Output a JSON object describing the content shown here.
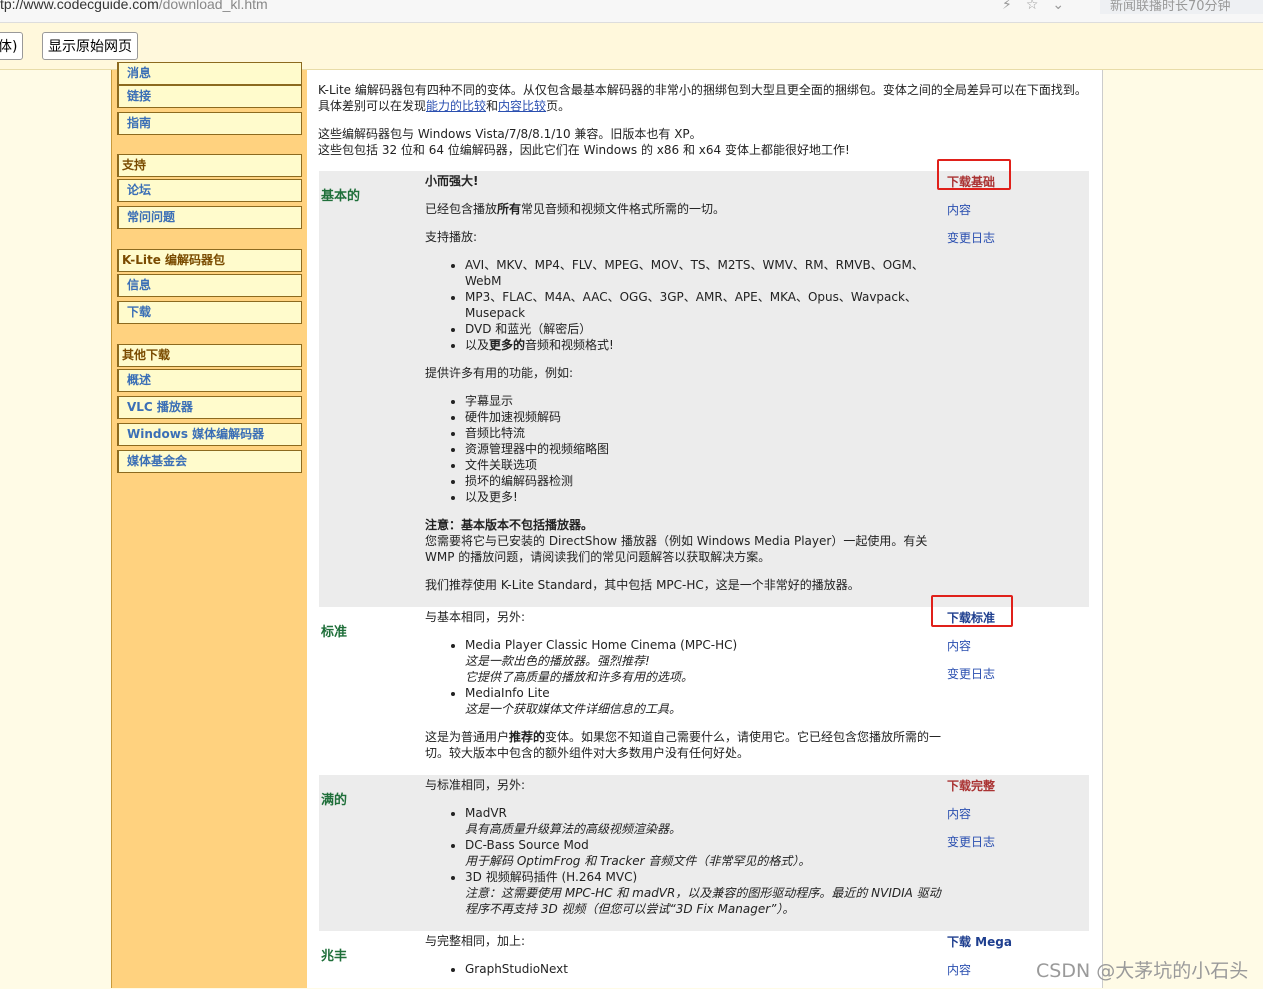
{
  "browser": {
    "url_host": "tp://www.codecguide.com",
    "url_path": "/download_kl.htm",
    "side_news": "新闻联播时长70分钟"
  },
  "translate_bar": {
    "partial_label": "体)",
    "show_original": "显示原始网页"
  },
  "sidebar": {
    "items": [
      {
        "label": "消息",
        "type": "item"
      },
      {
        "label": "链接",
        "type": "item"
      },
      {
        "label": "指南",
        "type": "item"
      },
      {
        "label": "支持",
        "type": "head"
      },
      {
        "label": "论坛",
        "type": "item"
      },
      {
        "label": "常问问题",
        "type": "item"
      },
      {
        "label": "K-Lite 编解码器包",
        "type": "head"
      },
      {
        "label": "信息",
        "type": "item"
      },
      {
        "label": "下载",
        "type": "item"
      },
      {
        "label": "其他下载",
        "type": "head"
      },
      {
        "label": "概述",
        "type": "item"
      },
      {
        "label": "VLC 播放器",
        "type": "item"
      },
      {
        "label": "Windows 媒体编解码器",
        "type": "item"
      },
      {
        "label": "媒体基金会",
        "type": "item"
      }
    ]
  },
  "intro": {
    "line1": "K-Lite 编解码器包有四种不同的变体。从仅包含最基本解码器的非常小的捆绑包到大型且更全面的捆绑包。变体之间的全局差异可以在下面找到。",
    "line2_pre": "具体差别可以在发现",
    "line2_link1": "能力的比较",
    "line2_mid": "和",
    "line2_link2": "内容比较",
    "line2_post": "页。",
    "line3": "这些编解码器包与 Windows Vista/7/8/8.1/10 兼容。旧版本也有 XP。",
    "line4": "这些包包括 32 位和 64 位编解码器，因此它们在 Windows 的 x86 和 x64 变体上都能很好地工作!"
  },
  "basic": {
    "name": "基本的",
    "tagline": "小而强大!",
    "desc_pre": "已经包含播放",
    "desc_bold": "所有",
    "desc_post": "常见音频和视频文件格式所需的一切。",
    "supports": "支持播放:",
    "formats": [
      "AVI、MKV、MP4、FLV、MPEG、MOV、TS、M2TS、WMV、RM、RMVB、OGM、WebM",
      "MP3、FLAC、M4A、AAC、OGG、3GP、AMR、APE、MKA、Opus、Wavpack、Musepack",
      "DVD 和蓝光（解密后）"
    ],
    "formats_last_pre": "以及",
    "formats_last_bold": "更多的",
    "formats_last_post": "音频和视频格式!",
    "features_intro": "提供许多有用的功能，例如:",
    "features": [
      "字幕显示",
      "硬件加速视频解码",
      "音频比特流",
      "资源管理器中的视频缩略图",
      "文件关联选项",
      "损坏的编解码器检测",
      "以及更多!"
    ],
    "note_bold": "注意：基本版本不包括播放器。",
    "note_text": "您需要将它与已安装的 DirectShow 播放器（例如 Windows Media Player）一起使用。有关 WMP 的播放问题，请阅读我们的常见问题解答以获取解决方案。",
    "recommend": "我们推荐使用 K-Lite Standard，其中包括 MPC-HC，这是一个非常好的播放器。",
    "download": "下载基础",
    "contents": "内容",
    "changelog": "变更日志"
  },
  "standard": {
    "name": "标准",
    "intro": "与基本相同，另外:",
    "items": [
      {
        "title": "Media Player Classic Home Cinema (MPC-HC)",
        "notes": [
          "这是一款出色的播放器。强烈推荐!",
          "它提供了高质量的播放和许多有用的选项。"
        ]
      },
      {
        "title": "MediaInfo Lite",
        "notes": [
          "这是一个获取媒体文件详细信息的工具。"
        ]
      }
    ],
    "summary_pre": "这是为普通用户",
    "summary_bold": "推荐的",
    "summary_post": "变体。如果您不知道自己需要什么，请使用它。它已经包含您播放所需的一切。较大版本中包含的额外组件对大多数用户没有任何好处。",
    "download": "下载标准",
    "contents": "内容",
    "changelog": "变更日志"
  },
  "full": {
    "name": "满的",
    "intro": "与标准相同，另外:",
    "items": [
      {
        "title": "MadVR",
        "notes": [
          "具有高质量升级算法的高级视频渲染器。"
        ]
      },
      {
        "title": "DC-Bass Source Mod",
        "notes": [
          "用于解码 OptimFrog 和 Tracker 音频文件（非常罕见的格式）。"
        ]
      },
      {
        "title": "3D 视频解码插件 (H.264 MVC)",
        "notes": [
          "注意：这需要使用 MPC-HC 和 madVR，以及兼容的图形驱动程序。最近的 NVIDIA 驱动程序不再支持 3D 视频（但您可以尝试“3D Fix Manager”）。"
        ]
      }
    ],
    "download": "下载完整",
    "contents": "内容",
    "changelog": "变更日志"
  },
  "mega": {
    "name": "兆丰",
    "intro": "与完整相同，加上:",
    "items": [
      "GraphStudioNext"
    ],
    "download": "下载 Mega",
    "contents": "内容"
  },
  "watermark": "CSDN @大茅坑的小石头",
  "colors": {
    "sidebar_bg": "#ffd27f",
    "highlight_box": "#e0201a",
    "section_name": "#1f6f3a"
  }
}
